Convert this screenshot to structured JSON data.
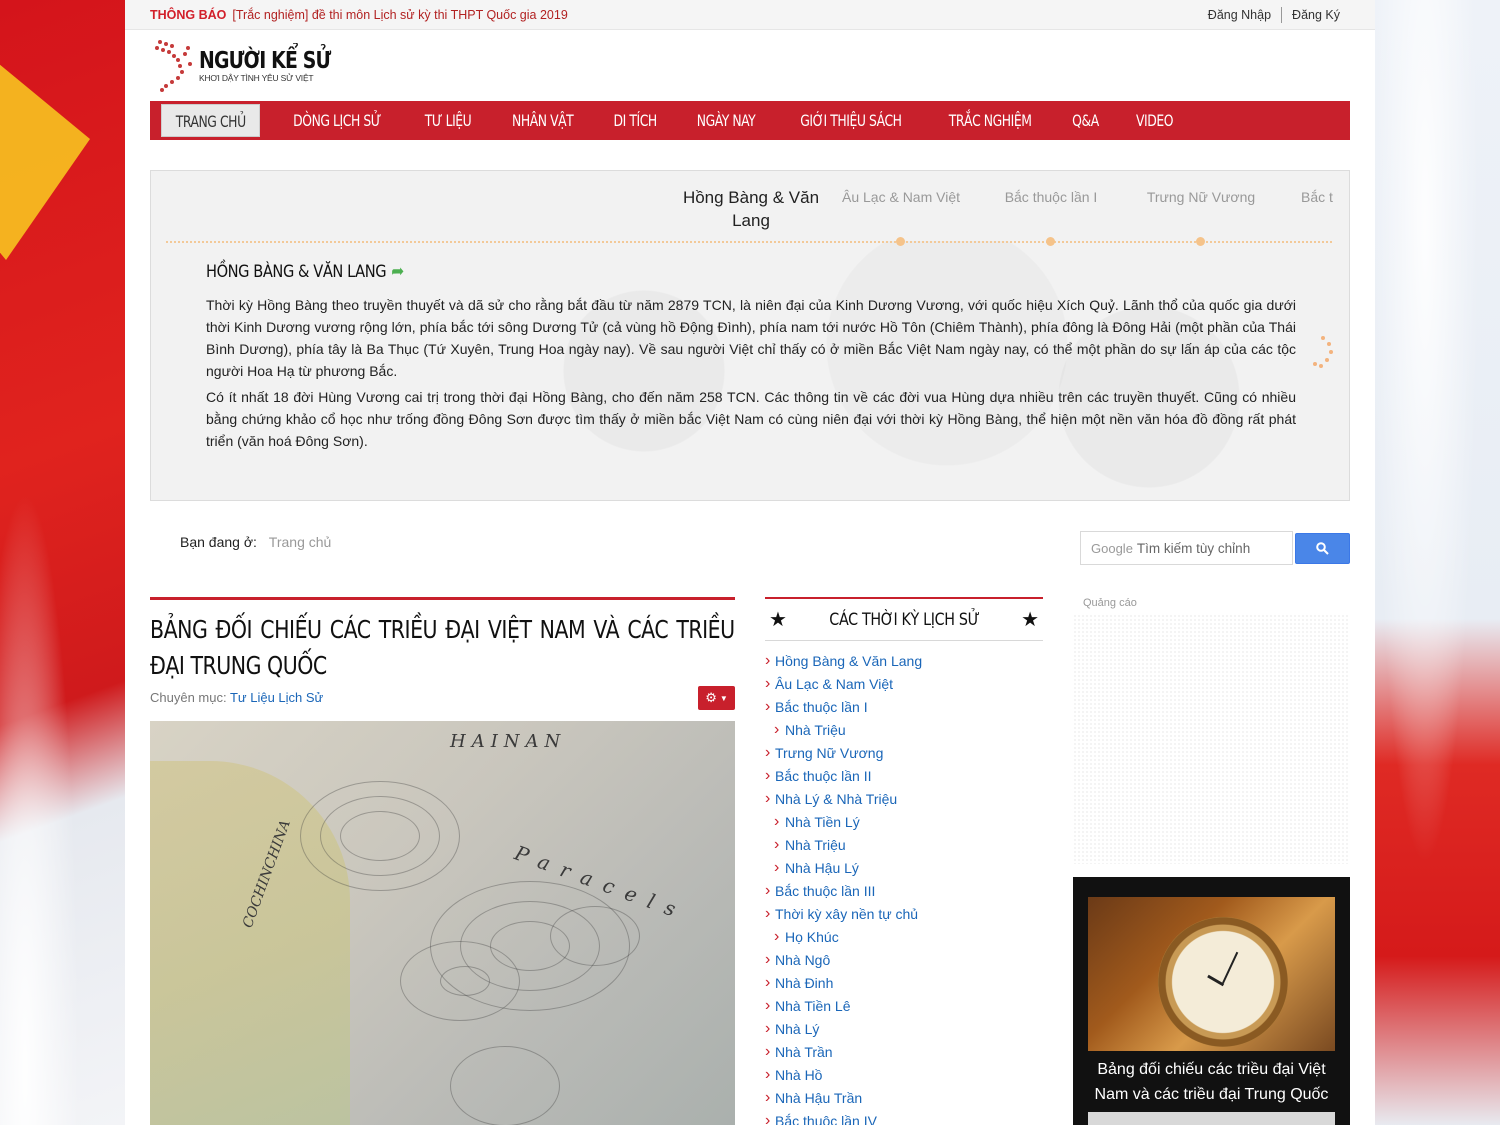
{
  "topbar": {
    "notice_label": "THÔNG BÁO",
    "notice_text": "[Trắc nghiệm] đề thi môn Lịch sử kỳ thi THPT Quốc gia 2019",
    "login": "Đăng Nhập",
    "register": "Đăng Ký"
  },
  "logo": {
    "name": "NGƯỜI KỂ SỬ",
    "tagline": "KHƠI DẬY TÌNH YÊU SỬ VIỆT"
  },
  "nav": [
    "TRANG CHỦ",
    "DÒNG LỊCH SỬ",
    "TƯ LIỆU",
    "NHÂN VẬT",
    "DI TÍCH",
    "NGÀY NAY",
    "GIỚI THIỆU SÁCH",
    "TRẮC NGHIỆM",
    "Q&A",
    "VIDEO"
  ],
  "timeline": {
    "tabs": [
      "Hồng Bàng & Văn Lang",
      "Âu Lạc & Nam Việt",
      "Bắc thuộc lần I",
      "Trưng Nữ Vương",
      "Bắc t"
    ],
    "heading": "HỒNG BÀNG & VĂN LANG",
    "paragraphs": [
      "Thời kỳ Hồng Bàng theo truyền thuyết và dã sử cho rằng bắt đầu từ năm 2879 TCN, là niên đại của Kinh Dương Vương, với quốc hiệu Xích Quỷ. Lãnh thổ của quốc gia dưới thời Kinh Dương vương rộng lớn, phía bắc tới sông Dương Tử (cả vùng hồ Động Đình), phía nam tới nước Hồ Tôn (Chiêm Thành), phía đông là Đông Hải (một phần của Thái Bình Dương), phía tây là Ba Thục (Tứ Xuyên, Trung Hoa ngày nay). Về sau người Việt chỉ thấy có ở miền Bắc Việt Nam ngày nay, có thể một phần do sự lấn áp của các tộc người Hoa Hạ từ phương Bắc.",
      "Có ít nhất 18 đời Hùng Vương cai trị trong thời đại Hồng Bàng, cho đến năm 258 TCN. Các thông tin về các đời vua Hùng dựa nhiều trên các truyền thuyết. Cũng có nhiều bằng chứng khảo cổ học như trống đồng Đông Sơn được tìm thấy ở miền bắc Việt Nam có cùng niên đại với thời kỳ Hồng Bàng, thể hiện một nền văn hóa đồ đồng rất phát triển (văn hoá Đông Sơn)."
    ]
  },
  "breadcrumb": {
    "label": "Bạn đang ở:",
    "current": "Trang chủ"
  },
  "search": {
    "brand": "Google",
    "placeholder": "Tìm kiếm tùy chỉnh"
  },
  "article": {
    "title": "BẢNG ĐỐI CHIẾU CÁC TRIỀU ĐẠI VIỆT NAM VÀ CÁC TRIỀU ĐẠI TRUNG QUỐC",
    "category_label": "Chuyên mục:",
    "category": "Tư Liệu Lịch Sử"
  },
  "eras": {
    "title": "CÁC THỜI KỲ LỊCH SỬ",
    "items": [
      {
        "label": "Hồng Bàng & Văn Lang",
        "sub": false
      },
      {
        "label": "Âu Lạc & Nam Việt",
        "sub": false
      },
      {
        "label": "Bắc thuộc lần I",
        "sub": false
      },
      {
        "label": "Nhà Triệu",
        "sub": true
      },
      {
        "label": "Trưng Nữ Vương",
        "sub": false
      },
      {
        "label": "Bắc thuộc lần II",
        "sub": false
      },
      {
        "label": "Nhà Lý & Nhà Triệu",
        "sub": false
      },
      {
        "label": "Nhà Tiền Lý",
        "sub": true
      },
      {
        "label": "Nhà Triệu",
        "sub": true
      },
      {
        "label": "Nhà Hậu Lý",
        "sub": true
      },
      {
        "label": "Bắc thuộc lần III",
        "sub": false
      },
      {
        "label": "Thời kỳ xây nền tự chủ",
        "sub": false
      },
      {
        "label": "Họ Khúc",
        "sub": true
      },
      {
        "label": "Nhà Ngô",
        "sub": false
      },
      {
        "label": "Nhà Đinh",
        "sub": false
      },
      {
        "label": "Nhà Tiền Lê",
        "sub": false
      },
      {
        "label": "Nhà Lý",
        "sub": false
      },
      {
        "label": "Nhà Trần",
        "sub": false
      },
      {
        "label": "Nhà Hồ",
        "sub": false
      },
      {
        "label": "Nhà Hậu Trần",
        "sub": false
      },
      {
        "label": "Bắc thuộc lần IV",
        "sub": false
      }
    ]
  },
  "sidebar": {
    "ads_label": "Quảng cáo",
    "featured_caption": "Bảng đối chiếu các triều đại Việt Nam và các triều đại Trung Quốc"
  },
  "colors": {
    "brand_red": "#c8202c",
    "link_blue": "#1a66b8",
    "search_blue": "#4a86e8"
  }
}
